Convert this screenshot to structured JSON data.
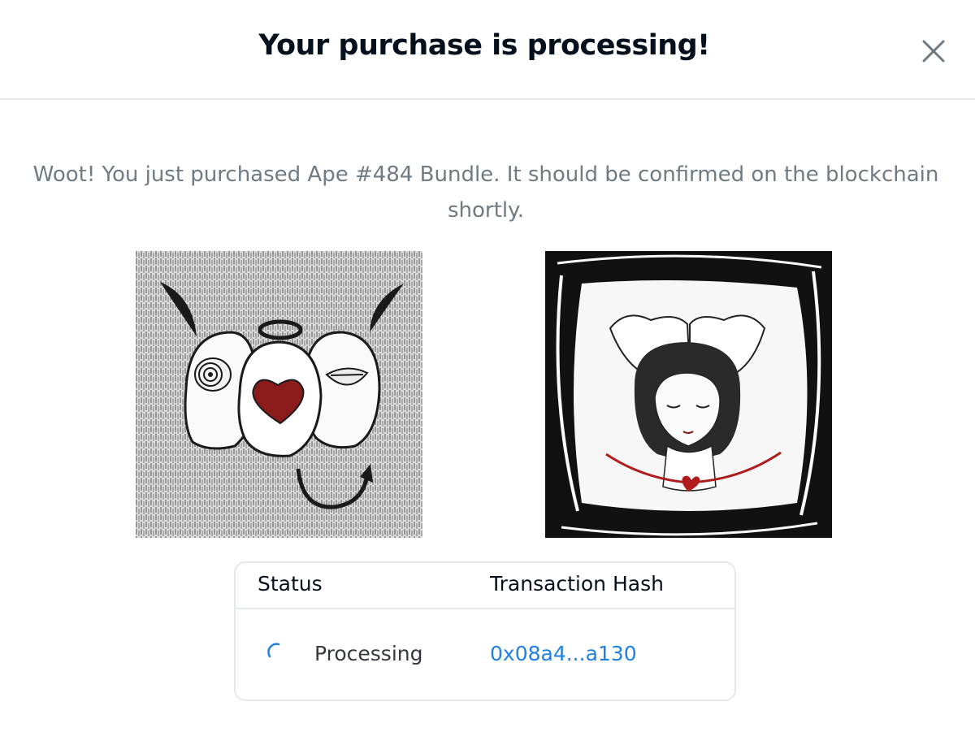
{
  "modal": {
    "title": "Your purchase is processing!",
    "close_icon": "close-icon",
    "message": "Woot! You just purchased Ape #484 Bundle. It should be confirmed on the blockchain shortly."
  },
  "items": [
    {
      "name": "ape-artwork-1",
      "icon": "nft-image"
    },
    {
      "name": "ape-artwork-2",
      "icon": "nft-image"
    }
  ],
  "transaction": {
    "status_header": "Status",
    "hash_header": "Transaction Hash",
    "status": "Processing",
    "hash": "0x08a4...a130"
  },
  "colors": {
    "title": "#04111d",
    "message": "#707a83",
    "link": "#2081e2",
    "border": "#e5e8eb",
    "spinner": "#2081e2"
  }
}
